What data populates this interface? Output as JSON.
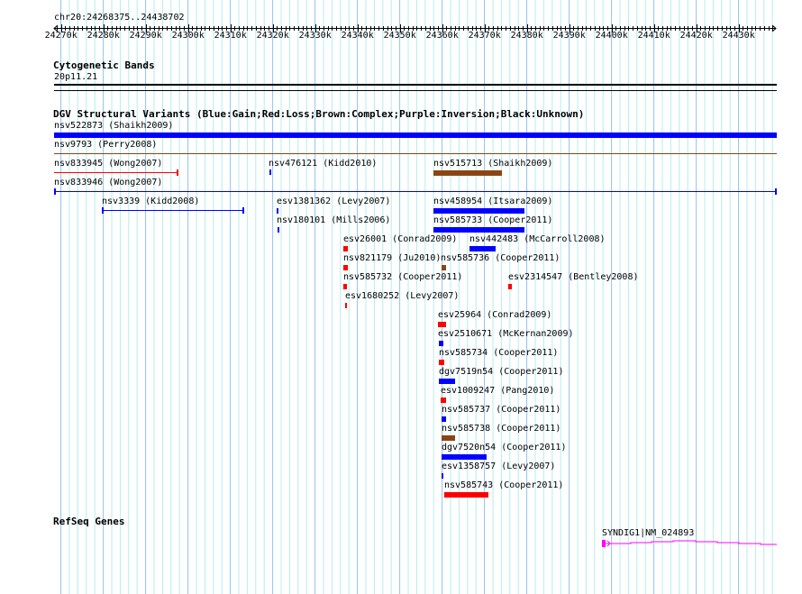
{
  "ruler": {
    "region": "chr20:24268375..24438702",
    "ticks": [
      "24270k",
      "24280k",
      "24290k",
      "24300k",
      "24310k",
      "24320k",
      "24330k",
      "24340k",
      "24350k",
      "24360k",
      "24370k",
      "24380k",
      "24390k",
      "24400k",
      "24410k",
      "24420k",
      "24430k"
    ]
  },
  "cytoband": {
    "title": "Cytogenetic Bands",
    "band": "20p11.21"
  },
  "dgv": {
    "title": "DGV Structural Variants (Blue:Gain;Red:Loss;Brown:Complex;Purple:Inversion;Black:Unknown)",
    "colors": {
      "gain": "#0000ff",
      "loss": "#ff0000",
      "complex": "#8b4513"
    },
    "features": [
      {
        "label": "nsv522873 (Shaikh2009)",
        "type": "gain"
      },
      {
        "label": "nsv9793 (Perry2008)",
        "type": "complex"
      },
      {
        "label": "nsv833945 (Wong2007)",
        "type": "loss"
      },
      {
        "label": "nsv476121 (Kidd2010)",
        "type": "gain"
      },
      {
        "label": "nsv515713 (Shaikh2009)",
        "type": "complex"
      },
      {
        "label": "nsv833946 (Wong2007)",
        "type": "gain"
      },
      {
        "label": "nsv3339 (Kidd2008)",
        "type": "gain"
      },
      {
        "label": "esv1381362 (Levy2007)",
        "type": "gain"
      },
      {
        "label": "nsv458954 (Itsara2009)",
        "type": "gain"
      },
      {
        "label": "nsv180101 (Mills2006)",
        "type": "gain"
      },
      {
        "label": "nsv585733 (Cooper2011)",
        "type": "gain"
      },
      {
        "label": "esv26001 (Conrad2009)",
        "type": "loss"
      },
      {
        "label": "nsv442483 (McCarroll2008)",
        "type": "gain"
      },
      {
        "label": "nsv821179 (Ju2010)",
        "type": "loss"
      },
      {
        "label": "nsv585736 (Cooper2011)",
        "type": "complex"
      },
      {
        "label": "nsv585732 (Cooper2011)",
        "type": "loss"
      },
      {
        "label": "esv2314547 (Bentley2008)",
        "type": "loss"
      },
      {
        "label": "esv1680252 (Levy2007)",
        "type": "loss"
      },
      {
        "label": "esv25964 (Conrad2009)",
        "type": "loss"
      },
      {
        "label": "esv2510671 (McKernan2009)",
        "type": "gain"
      },
      {
        "label": "nsv585734 (Cooper2011)",
        "type": "loss"
      },
      {
        "label": "dgv7519n54 (Cooper2011)",
        "type": "gain"
      },
      {
        "label": "esv1009247 (Pang2010)",
        "type": "loss"
      },
      {
        "label": "nsv585737 (Cooper2011)",
        "type": "gain"
      },
      {
        "label": "nsv585738 (Cooper2011)",
        "type": "complex"
      },
      {
        "label": "dgv7520n54 (Cooper2011)",
        "type": "gain"
      },
      {
        "label": "esv1358757 (Levy2007)",
        "type": "gain"
      },
      {
        "label": "nsv585743 (Cooper2011)",
        "type": "loss"
      }
    ]
  },
  "refseq": {
    "title": "RefSeq Genes",
    "gene": "SYNDIG1|NM_024893",
    "color": "#ff00ff"
  }
}
